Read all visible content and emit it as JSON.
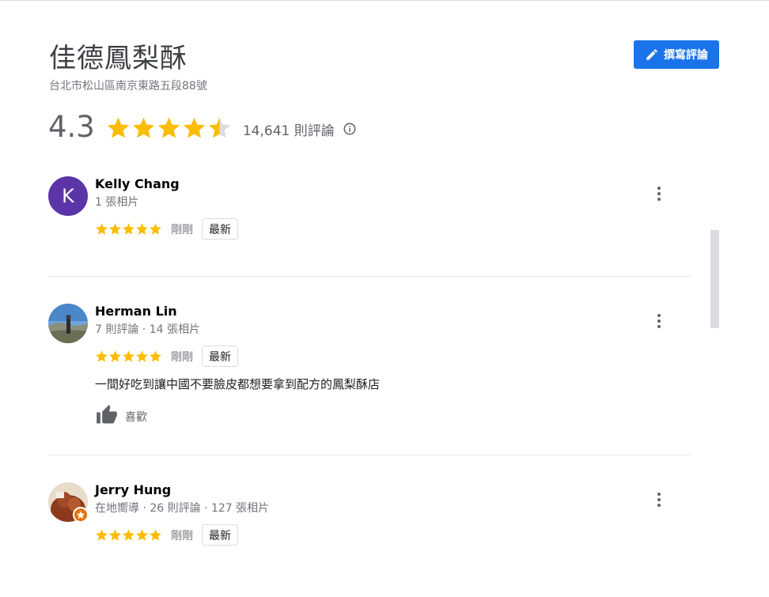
{
  "place": {
    "name": "佳德鳳梨酥",
    "address": "台北市松山區南京東路五段88號"
  },
  "write_review": {
    "label": "撰寫評論",
    "icon": "pencil-icon"
  },
  "summary": {
    "rating": "4.3",
    "rating_value": 4.3,
    "max_stars": 5,
    "review_count": "14,641 則評論",
    "info_icon": "info-icon"
  },
  "colors": {
    "star": "#fbbc04",
    "star_empty": "#dadce0",
    "accent": "#1a73e8",
    "avatar_k": "#5b35a8",
    "local_guide": "#e8710a"
  },
  "reviews": [
    {
      "name": "Kelly Chang",
      "meta": "1 張相片",
      "avatar_letter": "K",
      "stars": 5,
      "time": "剛剛",
      "badge": "最新"
    },
    {
      "name": "Herman Lin",
      "meta": "7 則評論 · 14 張相片",
      "stars": 5,
      "time": "剛剛",
      "badge": "最新",
      "text": "一間好吃到讓中國不要臉皮都想要拿到配方的鳳梨酥店",
      "like_label": "喜歡"
    },
    {
      "name": "Jerry Hung",
      "meta": "在地嚮導 · 26 則評論 · 127 張相片",
      "stars": 5,
      "time": "剛剛",
      "badge": "最新"
    }
  ]
}
